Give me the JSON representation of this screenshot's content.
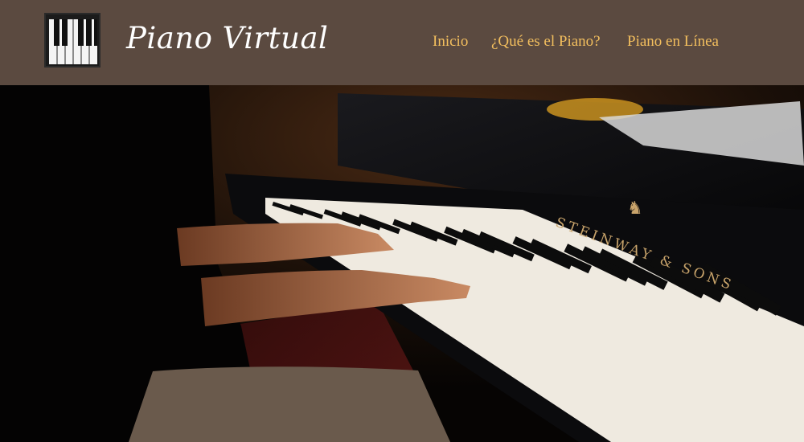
{
  "header": {
    "title": "Piano Virtual",
    "logo_icon": "piano-keys-icon",
    "background": "#5b4a40"
  },
  "nav": {
    "items": [
      {
        "label": "Inicio"
      },
      {
        "label": "¿Qué es el Piano?"
      },
      {
        "label": "Piano en Línea"
      }
    ],
    "link_color": "#f3bf5e"
  },
  "hero": {
    "brand_text": "STEINWAY & SONS"
  }
}
